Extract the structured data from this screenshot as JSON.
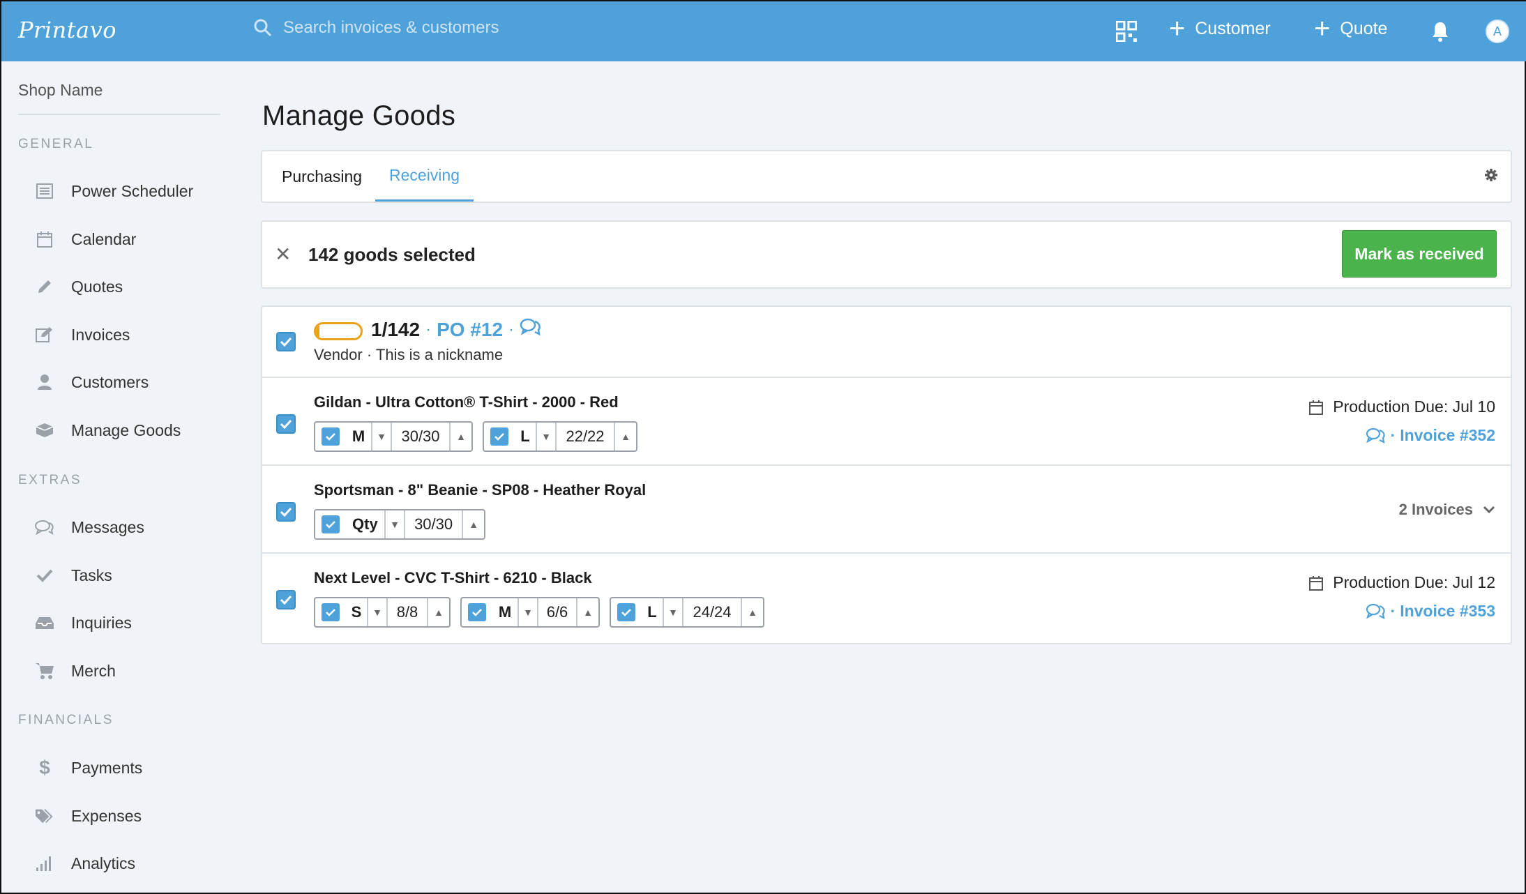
{
  "app": {
    "logo": "Printavo"
  },
  "search": {
    "placeholder": "Search invoices & customers"
  },
  "topbar": {
    "customer_label": "Customer",
    "quote_label": "Quote",
    "avatar_initial": "A"
  },
  "sidebar": {
    "shop_name": "Shop Name",
    "sections": {
      "general": "GENERAL",
      "extras": "EXTRAS",
      "financials": "FINANCIALS"
    },
    "items": [
      {
        "label": "Power Scheduler",
        "icon": "list-icon"
      },
      {
        "label": "Calendar",
        "icon": "calendar-icon"
      },
      {
        "label": "Quotes",
        "icon": "pencil-icon"
      },
      {
        "label": "Invoices",
        "icon": "edit-icon"
      },
      {
        "label": "Customers",
        "icon": "user-icon"
      },
      {
        "label": "Manage Goods",
        "icon": "box-icon"
      },
      {
        "label": "Messages",
        "icon": "chat-icon"
      },
      {
        "label": "Tasks",
        "icon": "check-icon"
      },
      {
        "label": "Inquiries",
        "icon": "inbox-icon"
      },
      {
        "label": "Merch",
        "icon": "cart-icon"
      },
      {
        "label": "Payments",
        "icon": "dollar-icon"
      },
      {
        "label": "Expenses",
        "icon": "tags-icon"
      },
      {
        "label": "Analytics",
        "icon": "bars-icon"
      }
    ]
  },
  "main": {
    "title": "Manage Goods",
    "tabs": [
      {
        "label": "Purchasing"
      },
      {
        "label": "Receiving"
      }
    ],
    "selection": {
      "count_text": "142 goods selected",
      "action_label": "Mark as received"
    },
    "po": {
      "progress": "1/142",
      "progress_fraction": 0.007,
      "po_label": "PO #12",
      "vendor": "Vendor",
      "nickname": "This is a nickname"
    },
    "goods": [
      {
        "title": "Gildan - Ultra Cotton® T-Shirt - 2000 - Red",
        "sizes": [
          {
            "size": "M",
            "value": "30/30"
          },
          {
            "size": "L",
            "value": "22/22"
          }
        ],
        "due": "Production Due: Jul 10",
        "invoice": "Invoice #352"
      },
      {
        "title": "Sportsman - 8\" Beanie - SP08 - Heather Royal",
        "sizes": [
          {
            "size": "Qty",
            "value": "30/30"
          }
        ],
        "invoices_label": "2 Invoices"
      },
      {
        "title": "Next Level - CVC T-Shirt - 6210 - Black",
        "sizes": [
          {
            "size": "S",
            "value": "8/8"
          },
          {
            "size": "M",
            "value": "6/6"
          },
          {
            "size": "L",
            "value": "24/24"
          }
        ],
        "due": "Production Due: Jul 12",
        "invoice": "Invoice #353"
      }
    ]
  },
  "colors": {
    "topbar": "#4ea2d9",
    "accent": "#4ea2d9",
    "success": "#4bb34b",
    "progress": "#e8a317"
  }
}
